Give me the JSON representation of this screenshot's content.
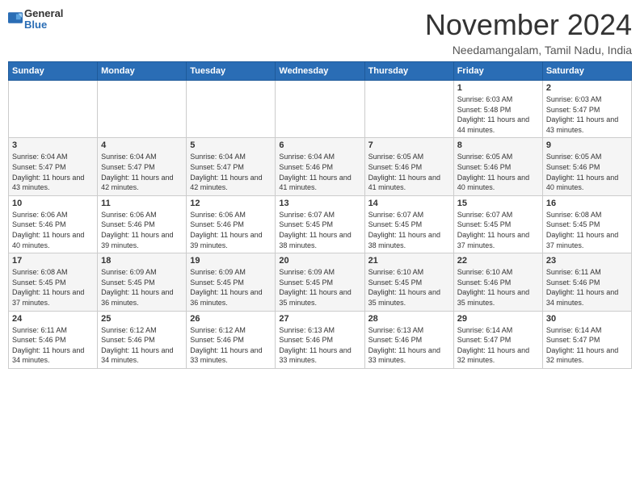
{
  "header": {
    "logo_general": "General",
    "logo_blue": "Blue",
    "month_title": "November 2024",
    "location": "Needamangalam, Tamil Nadu, India"
  },
  "weekdays": [
    "Sunday",
    "Monday",
    "Tuesday",
    "Wednesday",
    "Thursday",
    "Friday",
    "Saturday"
  ],
  "weeks": [
    [
      {
        "day": "",
        "info": ""
      },
      {
        "day": "",
        "info": ""
      },
      {
        "day": "",
        "info": ""
      },
      {
        "day": "",
        "info": ""
      },
      {
        "day": "",
        "info": ""
      },
      {
        "day": "1",
        "info": "Sunrise: 6:03 AM\nSunset: 5:48 PM\nDaylight: 11 hours and 44 minutes."
      },
      {
        "day": "2",
        "info": "Sunrise: 6:03 AM\nSunset: 5:47 PM\nDaylight: 11 hours and 43 minutes."
      }
    ],
    [
      {
        "day": "3",
        "info": "Sunrise: 6:04 AM\nSunset: 5:47 PM\nDaylight: 11 hours and 43 minutes."
      },
      {
        "day": "4",
        "info": "Sunrise: 6:04 AM\nSunset: 5:47 PM\nDaylight: 11 hours and 42 minutes."
      },
      {
        "day": "5",
        "info": "Sunrise: 6:04 AM\nSunset: 5:47 PM\nDaylight: 11 hours and 42 minutes."
      },
      {
        "day": "6",
        "info": "Sunrise: 6:04 AM\nSunset: 5:46 PM\nDaylight: 11 hours and 41 minutes."
      },
      {
        "day": "7",
        "info": "Sunrise: 6:05 AM\nSunset: 5:46 PM\nDaylight: 11 hours and 41 minutes."
      },
      {
        "day": "8",
        "info": "Sunrise: 6:05 AM\nSunset: 5:46 PM\nDaylight: 11 hours and 40 minutes."
      },
      {
        "day": "9",
        "info": "Sunrise: 6:05 AM\nSunset: 5:46 PM\nDaylight: 11 hours and 40 minutes."
      }
    ],
    [
      {
        "day": "10",
        "info": "Sunrise: 6:06 AM\nSunset: 5:46 PM\nDaylight: 11 hours and 40 minutes."
      },
      {
        "day": "11",
        "info": "Sunrise: 6:06 AM\nSunset: 5:46 PM\nDaylight: 11 hours and 39 minutes."
      },
      {
        "day": "12",
        "info": "Sunrise: 6:06 AM\nSunset: 5:46 PM\nDaylight: 11 hours and 39 minutes."
      },
      {
        "day": "13",
        "info": "Sunrise: 6:07 AM\nSunset: 5:45 PM\nDaylight: 11 hours and 38 minutes."
      },
      {
        "day": "14",
        "info": "Sunrise: 6:07 AM\nSunset: 5:45 PM\nDaylight: 11 hours and 38 minutes."
      },
      {
        "day": "15",
        "info": "Sunrise: 6:07 AM\nSunset: 5:45 PM\nDaylight: 11 hours and 37 minutes."
      },
      {
        "day": "16",
        "info": "Sunrise: 6:08 AM\nSunset: 5:45 PM\nDaylight: 11 hours and 37 minutes."
      }
    ],
    [
      {
        "day": "17",
        "info": "Sunrise: 6:08 AM\nSunset: 5:45 PM\nDaylight: 11 hours and 37 minutes."
      },
      {
        "day": "18",
        "info": "Sunrise: 6:09 AM\nSunset: 5:45 PM\nDaylight: 11 hours and 36 minutes."
      },
      {
        "day": "19",
        "info": "Sunrise: 6:09 AM\nSunset: 5:45 PM\nDaylight: 11 hours and 36 minutes."
      },
      {
        "day": "20",
        "info": "Sunrise: 6:09 AM\nSunset: 5:45 PM\nDaylight: 11 hours and 35 minutes."
      },
      {
        "day": "21",
        "info": "Sunrise: 6:10 AM\nSunset: 5:45 PM\nDaylight: 11 hours and 35 minutes."
      },
      {
        "day": "22",
        "info": "Sunrise: 6:10 AM\nSunset: 5:46 PM\nDaylight: 11 hours and 35 minutes."
      },
      {
        "day": "23",
        "info": "Sunrise: 6:11 AM\nSunset: 5:46 PM\nDaylight: 11 hours and 34 minutes."
      }
    ],
    [
      {
        "day": "24",
        "info": "Sunrise: 6:11 AM\nSunset: 5:46 PM\nDaylight: 11 hours and 34 minutes."
      },
      {
        "day": "25",
        "info": "Sunrise: 6:12 AM\nSunset: 5:46 PM\nDaylight: 11 hours and 34 minutes."
      },
      {
        "day": "26",
        "info": "Sunrise: 6:12 AM\nSunset: 5:46 PM\nDaylight: 11 hours and 33 minutes."
      },
      {
        "day": "27",
        "info": "Sunrise: 6:13 AM\nSunset: 5:46 PM\nDaylight: 11 hours and 33 minutes."
      },
      {
        "day": "28",
        "info": "Sunrise: 6:13 AM\nSunset: 5:46 PM\nDaylight: 11 hours and 33 minutes."
      },
      {
        "day": "29",
        "info": "Sunrise: 6:14 AM\nSunset: 5:47 PM\nDaylight: 11 hours and 32 minutes."
      },
      {
        "day": "30",
        "info": "Sunrise: 6:14 AM\nSunset: 5:47 PM\nDaylight: 11 hours and 32 minutes."
      }
    ]
  ]
}
